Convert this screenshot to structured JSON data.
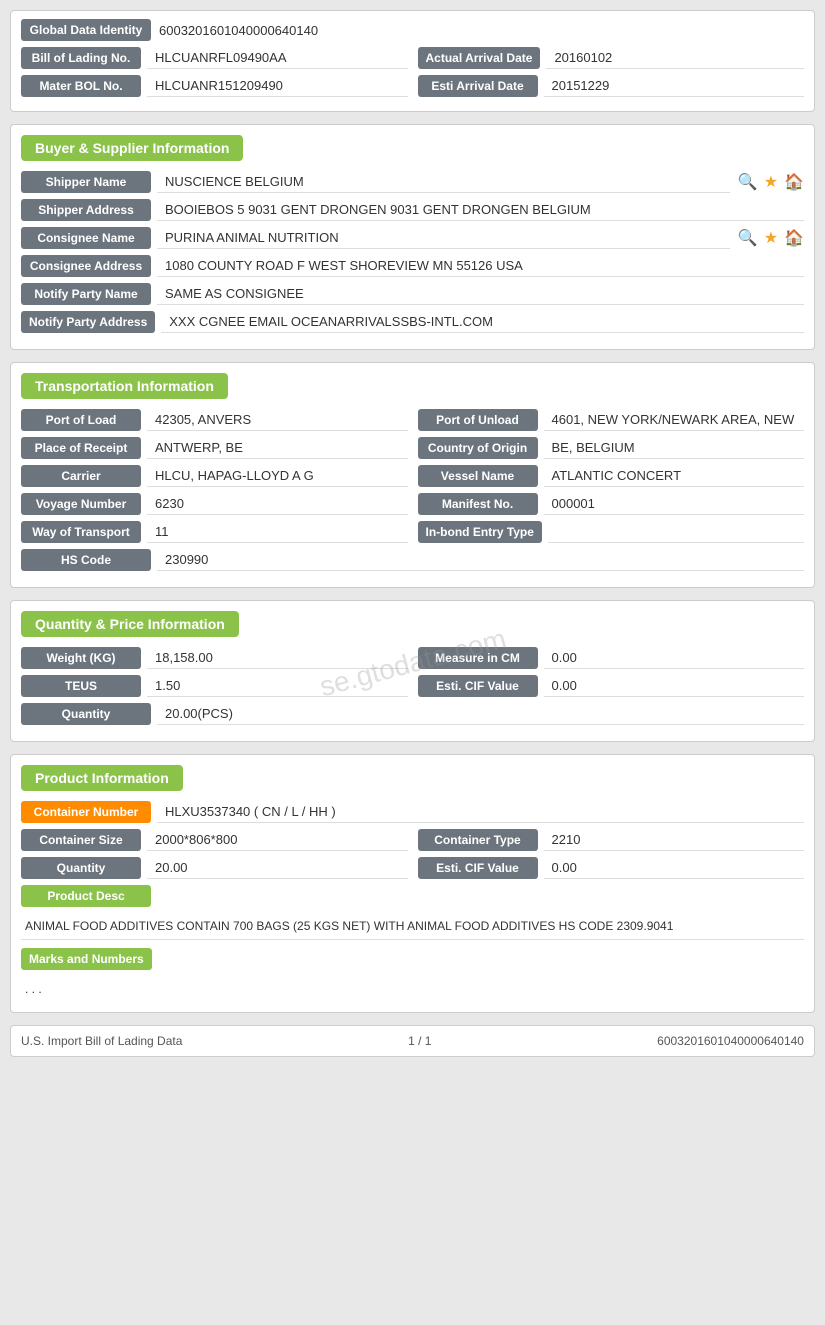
{
  "globalId": {
    "label": "Global Data Identity",
    "value": "6003201601040000640140"
  },
  "billOfLading": {
    "label": "Bill of Lading No.",
    "value": "HLCUANRFL09490AA",
    "actualArrivalLabel": "Actual Arrival Date",
    "actualArrivalValue": "20160102"
  },
  "masterBol": {
    "label": "Mater BOL No.",
    "value": "HLCUANR151209490",
    "estiArrivalLabel": "Esti Arrival Date",
    "estiArrivalValue": "20151229"
  },
  "buyerSupplier": {
    "sectionTitle": "Buyer & Supplier Information",
    "shipperNameLabel": "Shipper Name",
    "shipperNameValue": "NUSCIENCE BELGIUM",
    "shipperAddressLabel": "Shipper Address",
    "shipperAddressValue": "BOOIEBOS 5 9031 GENT DRONGEN 9031 GENT DRONGEN BELGIUM",
    "consigneeNameLabel": "Consignee Name",
    "consigneeNameValue": "PURINA ANIMAL NUTRITION",
    "consigneeAddressLabel": "Consignee Address",
    "consigneeAddressValue": "1080 COUNTY ROAD F WEST SHOREVIEW MN 55126 USA",
    "notifyPartyNameLabel": "Notify Party Name",
    "notifyPartyNameValue": "SAME AS CONSIGNEE",
    "notifyPartyAddressLabel": "Notify Party Address",
    "notifyPartyAddressValue": "XXX CGNEE EMAIL OCEANARRIVALSSBS-INTL.COM"
  },
  "transportation": {
    "sectionTitle": "Transportation Information",
    "portOfLoadLabel": "Port of Load",
    "portOfLoadValue": "42305, ANVERS",
    "portOfUnloadLabel": "Port of Unload",
    "portOfUnloadValue": "4601, NEW YORK/NEWARK AREA, NEW",
    "placeOfReceiptLabel": "Place of Receipt",
    "placeOfReceiptValue": "ANTWERP, BE",
    "countryOfOriginLabel": "Country of Origin",
    "countryOfOriginValue": "BE, BELGIUM",
    "carrierLabel": "Carrier",
    "carrierValue": "HLCU, HAPAG-LLOYD A G",
    "vesselNameLabel": "Vessel Name",
    "vesselNameValue": "ATLANTIC CONCERT",
    "voyageNumberLabel": "Voyage Number",
    "voyageNumberValue": "6230",
    "manifestNoLabel": "Manifest No.",
    "manifestNoValue": "000001",
    "wayOfTransportLabel": "Way of Transport",
    "wayOfTransportValue": "11",
    "inBondEntryTypeLabel": "In-bond Entry Type",
    "inBondEntryTypeValue": "",
    "hsCodeLabel": "HS Code",
    "hsCodeValue": "230990"
  },
  "quantityPrice": {
    "sectionTitle": "Quantity & Price Information",
    "weightLabel": "Weight (KG)",
    "weightValue": "18,158.00",
    "measureInCMLabel": "Measure in CM",
    "measureInCMValue": "0.00",
    "teusLabel": "TEUS",
    "teusValue": "1.50",
    "estiCIFLabel": "Esti. CIF Value",
    "estiCIFValue": "0.00",
    "quantityLabel": "Quantity",
    "quantityValue": "20.00(PCS)"
  },
  "productInfo": {
    "sectionTitle": "Product Information",
    "containerNumberLabel": "Container Number",
    "containerNumberValue": "HLXU3537340 ( CN / L / HH )",
    "containerSizeLabel": "Container Size",
    "containerSizeValue": "2000*806*800",
    "containerTypeLabel": "Container Type",
    "containerTypeValue": "2210",
    "quantityLabel": "Quantity",
    "quantityValue": "20.00",
    "estiCIFLabel": "Esti. CIF Value",
    "estiCIFValue": "0.00",
    "productDescLabel": "Product Desc",
    "productDescText": "ANIMAL FOOD ADDITIVES CONTAIN 700 BAGS (25 KGS NET) WITH ANIMAL FOOD ADDITIVES HS CODE 2309.9041",
    "marksAndNumbersLabel": "Marks and Numbers",
    "marksAndNumbersText": ". . ."
  },
  "footer": {
    "leftText": "U.S. Import Bill of Lading Data",
    "pageText": "1 / 1",
    "rightText": "6003201601040000640140"
  },
  "watermark": "se.gtodata.com"
}
